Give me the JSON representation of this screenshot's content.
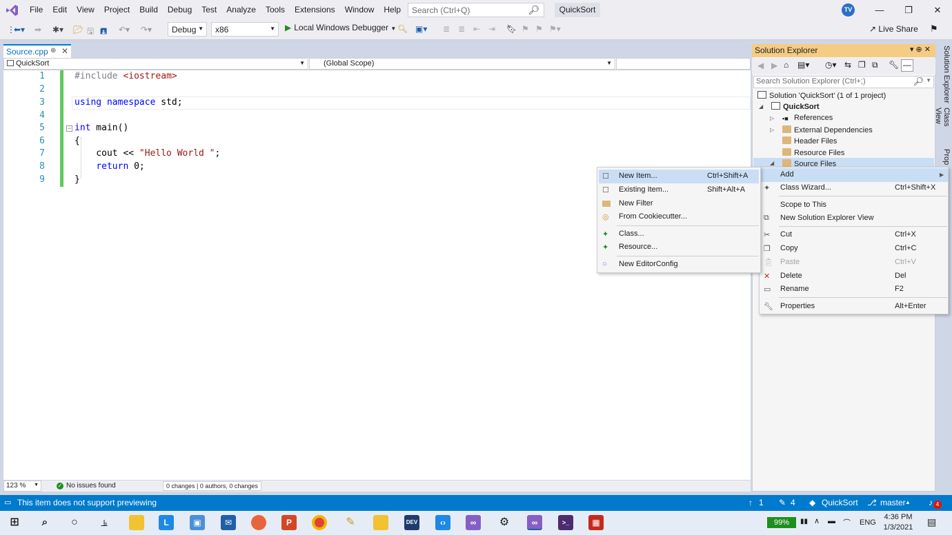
{
  "menu": [
    "File",
    "Edit",
    "View",
    "Project",
    "Build",
    "Debug",
    "Test",
    "Analyze",
    "Tools",
    "Extensions",
    "Window",
    "Help"
  ],
  "search": {
    "placeholder": "Search (Ctrl+Q)"
  },
  "solution_badge": "QuickSort",
  "user_initials": "TV",
  "toolbar": {
    "config": "Debug",
    "platform": "x86",
    "debugger": "Local Windows Debugger",
    "live_share": "Live Share"
  },
  "editor": {
    "tab": "Source.cpp",
    "nav_project": "QuickSort",
    "nav_scope": "(Global Scope)",
    "line_numbers": [
      "1",
      "2",
      "3",
      "4",
      "5",
      "6",
      "7",
      "8",
      "9"
    ],
    "code": {
      "l1_a": "#include ",
      "l1_b": "<iostream>",
      "l3_a": "using",
      "l3_b": "namespace",
      "l3_c": " std;",
      "l5_a": "int",
      "l5_b": " main()",
      "l6": "{",
      "l7_a": "    cout << ",
      "l7_b": "\"Hello World \"",
      "l7_c": ";",
      "l8_a": "    ",
      "l8_b": "return",
      "l8_c": " 0;",
      "l9": "}"
    },
    "zoom": "123 %",
    "issues": "No issues found",
    "changes": "0 changes | 0 authors, 0 changes"
  },
  "solution_explorer": {
    "title": "Solution Explorer",
    "search_placeholder": "Search Solution Explorer (Ctrl+;)",
    "solution": "Solution 'QuickSort' (1 of 1 project)",
    "project": "QuickSort",
    "items": [
      "References",
      "External Dependencies",
      "Header Files",
      "Resource Files",
      "Source Files"
    ]
  },
  "side_tabs": [
    "Solution Explorer",
    "Class View",
    "Prop"
  ],
  "context_menu": {
    "items": [
      {
        "label": "Add",
        "shortcut": ""
      },
      {
        "label": "Class Wizard...",
        "shortcut": "Ctrl+Shift+X"
      },
      {
        "label": "Scope to This",
        "shortcut": ""
      },
      {
        "label": "New Solution Explorer View",
        "shortcut": ""
      },
      {
        "label": "Cut",
        "shortcut": "Ctrl+X"
      },
      {
        "label": "Copy",
        "shortcut": "Ctrl+C"
      },
      {
        "label": "Paste",
        "shortcut": "Ctrl+V"
      },
      {
        "label": "Delete",
        "shortcut": "Del"
      },
      {
        "label": "Rename",
        "shortcut": "F2"
      },
      {
        "label": "Properties",
        "shortcut": "Alt+Enter"
      }
    ]
  },
  "add_submenu": {
    "items": [
      {
        "label": "New Item...",
        "shortcut": "Ctrl+Shift+A"
      },
      {
        "label": "Existing Item...",
        "shortcut": "Shift+Alt+A"
      },
      {
        "label": "New Filter",
        "shortcut": ""
      },
      {
        "label": "From Cookiecutter...",
        "shortcut": ""
      },
      {
        "label": "Class...",
        "shortcut": ""
      },
      {
        "label": "Resource...",
        "shortcut": ""
      },
      {
        "label": "New EditorConfig",
        "shortcut": ""
      }
    ]
  },
  "statusbar": {
    "message": "This item does not support previewing",
    "up_count": "1",
    "edit_count": "4",
    "repo": "QuickSort",
    "branch": "master",
    "notifications": "4"
  },
  "taskbar": {
    "battery": "99%",
    "lang": "ENG",
    "time": "4:36 PM",
    "date": "1/3/2021"
  },
  "colors": {
    "accent": "#007acc",
    "panel_title": "#f5cc84",
    "menu_highlight": "#c9def5",
    "change_bar": "#5fc95f"
  }
}
